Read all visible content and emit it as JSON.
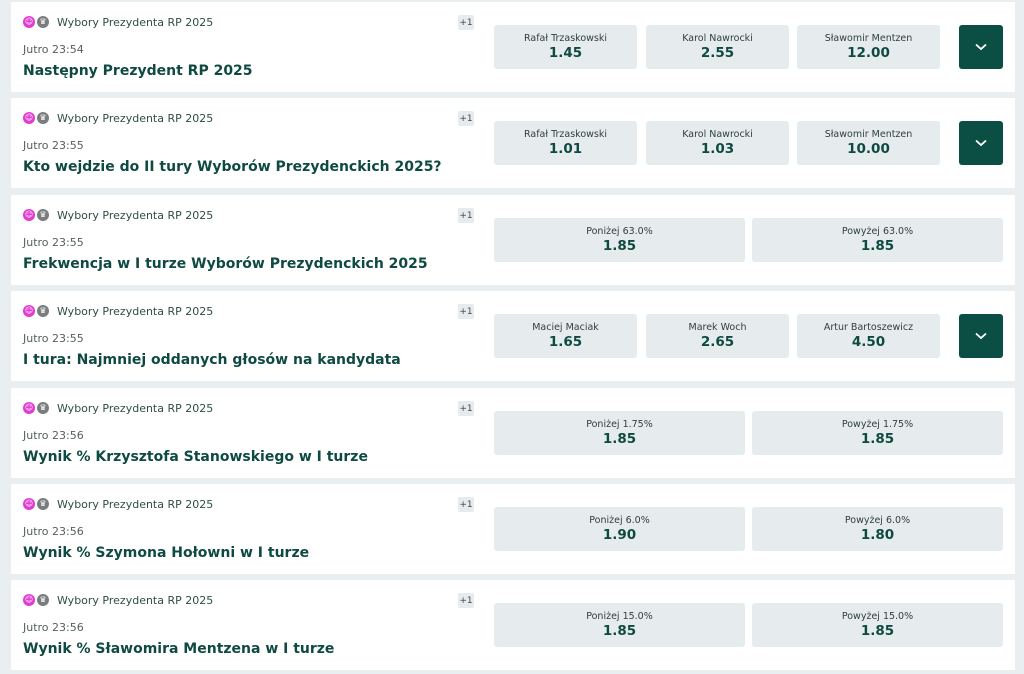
{
  "events": [
    {
      "competition": "Wybory Prezydenta RP 2025",
      "extra": "+1",
      "time": "Jutro 23:54",
      "title": "Następny Prezydent RP 2025",
      "icons": [
        "smiley-icon",
        "trophy-icon"
      ],
      "has_more": true,
      "odds": [
        {
          "label": "Rafał Trzaskowski",
          "value": "1.45"
        },
        {
          "label": "Karol Nawrocki",
          "value": "2.55"
        },
        {
          "label": "Sławomir Mentzen",
          "value": "12.00"
        }
      ]
    },
    {
      "competition": "Wybory Prezydenta RP 2025",
      "extra": "+1",
      "time": "Jutro 23:55",
      "title": "Kto wejdzie do II tury Wyborów Prezydenckich 2025?",
      "icons": [
        "smiley-icon",
        "trophy-icon"
      ],
      "has_more": true,
      "odds": [
        {
          "label": "Rafał Trzaskowski",
          "value": "1.01"
        },
        {
          "label": "Karol Nawrocki",
          "value": "1.03"
        },
        {
          "label": "Sławomir Mentzen",
          "value": "10.00"
        }
      ]
    },
    {
      "competition": "Wybory Prezydenta RP 2025",
      "extra": "+1",
      "time": "Jutro 23:55",
      "title": "Frekwencja w I turze Wyborów Prezydenckich 2025",
      "icons": [
        "smiley-icon",
        "trophy-icon"
      ],
      "has_more": false,
      "odds": [
        {
          "label": "Poniżej 63.0%",
          "value": "1.85"
        },
        {
          "label": "Powyżej 63.0%",
          "value": "1.85"
        }
      ]
    },
    {
      "competition": "Wybory Prezydenta RP 2025",
      "extra": "+1",
      "time": "Jutro 23:55",
      "title": "I tura: Najmniej oddanych głosów na kandydata",
      "icons": [
        "smiley-icon",
        "trophy-icon"
      ],
      "has_more": true,
      "odds": [
        {
          "label": "Maciej Maciak",
          "value": "1.65"
        },
        {
          "label": "Marek Woch",
          "value": "2.65"
        },
        {
          "label": "Artur Bartoszewicz",
          "value": "4.50"
        }
      ]
    },
    {
      "competition": "Wybory Prezydenta RP 2025",
      "extra": "+1",
      "time": "Jutro 23:56",
      "title": "Wynik % Krzysztofa Stanowskiego w I turze",
      "icons": [
        "smiley-icon",
        "trophy-icon"
      ],
      "has_more": false,
      "odds": [
        {
          "label": "Poniżej 1.75%",
          "value": "1.85"
        },
        {
          "label": "Powyżej 1.75%",
          "value": "1.85"
        }
      ]
    },
    {
      "competition": "Wybory Prezydenta RP 2025",
      "extra": "+1",
      "time": "Jutro 23:56",
      "title": "Wynik % Szymona Hołowni w I turze",
      "icons": [
        "smiley-icon",
        "trophy-icon"
      ],
      "has_more": false,
      "odds": [
        {
          "label": "Poniżej 6.0%",
          "value": "1.90"
        },
        {
          "label": "Powyżej 6.0%",
          "value": "1.80"
        }
      ]
    },
    {
      "competition": "Wybory Prezydenta RP 2025",
      "extra": "+1",
      "time": "Jutro 23:56",
      "title": "Wynik % Sławomira Mentzena w I turze",
      "icons": [
        "smiley-icon",
        "trophy-icon"
      ],
      "has_more": false,
      "odds": [
        {
          "label": "Poniżej 15.0%",
          "value": "1.85"
        },
        {
          "label": "Powyżej 15.0%",
          "value": "1.85"
        }
      ]
    }
  ],
  "colors": {
    "accent": "#0b4f44",
    "title_text": "#0f4a42",
    "odd_bg": "#e6ecee",
    "page_bg": "#e9eef0",
    "icon_pink": "#e23bd2"
  }
}
